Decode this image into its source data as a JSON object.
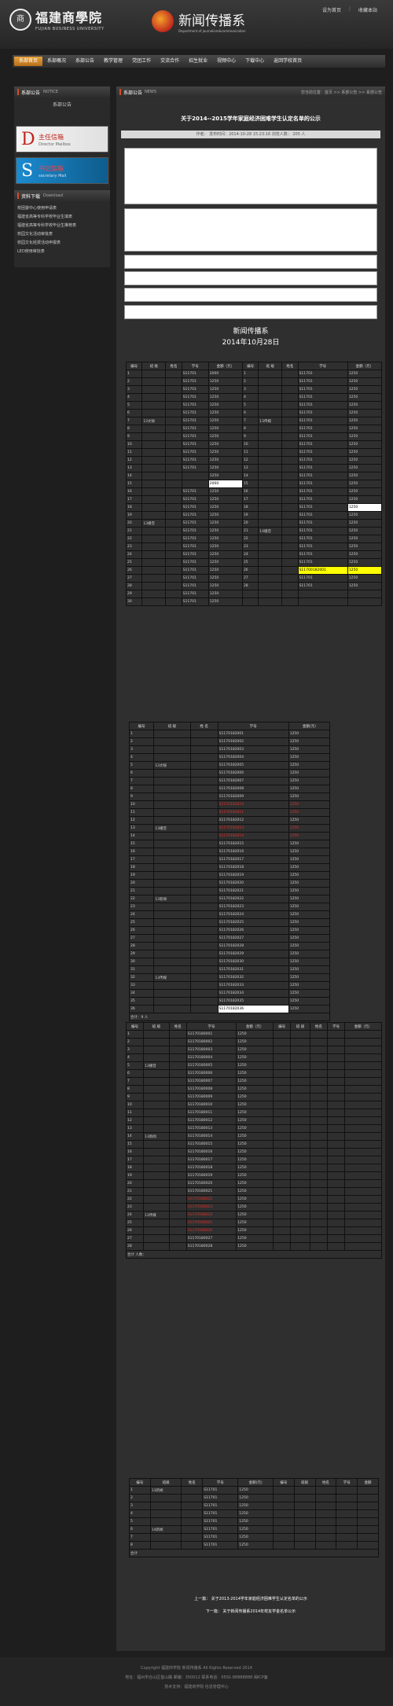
{
  "header": {
    "school_cn": "福建商學院",
    "school_en": "FUJIAN BUSINESS UNIVERSITY",
    "dept_cn": "新闻传播系",
    "dept_en": "Department of journalism&communication",
    "seal_char": "商",
    "top_links": [
      "设为首页",
      "收藏本站"
    ]
  },
  "nav": {
    "items": [
      "系部首页",
      "系部概况",
      "系部公告",
      "教学管理",
      "党团工作",
      "交流合作",
      "招生就业",
      "视频中心",
      "下载中心",
      "返回学校首页"
    ]
  },
  "sidebar": {
    "notice_title": "系部公告",
    "notice_en": "NOTICE",
    "notice_sub": "系部公告",
    "box1": {
      "letter": "D",
      "cn": "主任信箱",
      "en": "Director Mailbox"
    },
    "box2": {
      "letter": "S",
      "cn": "书记信箱",
      "en": "secretary Mail"
    },
    "download_title": "资料下载",
    "download_en": "Download",
    "downloads": [
      "校团委中心使用申请表",
      "福建省高等专科学校毕业生填表",
      "福建省高等专科学校毕业生推荐表",
      "校园文化活动审批表",
      "校园文化经费活动申报表",
      "LED使用审批表"
    ]
  },
  "main": {
    "title": "系部公告",
    "title_en": "NEWS",
    "breadcrumb": "您当前位置：首页 >> 系部公告 >> 系部公告",
    "article_title": "关于2014--2015学年家庭经济困难学生认定名单的公示",
    "article_meta": "作者： 发布时间：2014-10-28 15:23:16 浏览人数： 205 人",
    "dept_name": "新闻传播系",
    "date": "2014年10月28日",
    "prev_link": "上一篇： 关于2013-2014学年家庭经济困难学生认定名单的公示",
    "next_link": "下一篇： 关于新闻传播系2014年校友学金名单公示"
  },
  "table1": {
    "headers": [
      "编号",
      "班 级",
      "姓名",
      "学号",
      "金额（元）",
      "编号",
      "班 级",
      "姓名",
      "学号",
      "金额（元）"
    ],
    "left_rows": [
      [
        "1",
        "",
        "",
        "S11701",
        "2000"
      ],
      [
        "2",
        "",
        "",
        "S11701",
        "1250"
      ],
      [
        "3",
        "",
        "",
        "S11701",
        "1250"
      ],
      [
        "4",
        "",
        "",
        "S11701",
        "1250"
      ],
      [
        "5",
        "",
        "",
        "S11701",
        "1250"
      ],
      [
        "6",
        "",
        "",
        "S11701",
        "1250"
      ],
      [
        "7",
        "13文秘",
        "",
        "S11701",
        "1250"
      ],
      [
        "8",
        "",
        "",
        "S11701",
        "1250"
      ],
      [
        "9",
        "",
        "",
        "S11701",
        "1250"
      ],
      [
        "10",
        "",
        "",
        "S11701",
        "1250"
      ],
      [
        "11",
        "",
        "",
        "S11701",
        "1250"
      ],
      [
        "12",
        "",
        "",
        "S11701",
        "1250"
      ],
      [
        "13",
        "",
        "",
        "S11701",
        "1250"
      ],
      [
        "14",
        "",
        "",
        "",
        "1250"
      ],
      [
        "15",
        "",
        "",
        "",
        "2000"
      ],
      [
        "16",
        "",
        "",
        "S11701",
        "1250"
      ],
      [
        "17",
        "",
        "",
        "S11701",
        "1250"
      ],
      [
        "18",
        "",
        "",
        "S11701",
        "1250"
      ],
      [
        "19",
        "",
        "",
        "S11701",
        "1250"
      ],
      [
        "20",
        "13播音",
        "",
        "S11701",
        "1250"
      ],
      [
        "21",
        "",
        "",
        "S11701",
        "1250"
      ],
      [
        "22",
        "",
        "",
        "S11701",
        "1250"
      ],
      [
        "23",
        "",
        "",
        "S11701",
        "1250"
      ],
      [
        "24",
        "",
        "",
        "S11701",
        "1250"
      ],
      [
        "25",
        "",
        "",
        "S11701",
        "1250"
      ],
      [
        "26",
        "",
        "",
        "S11701",
        "1250"
      ],
      [
        "27",
        "",
        "",
        "S11701",
        "1250"
      ],
      [
        "28",
        "",
        "",
        "S11701",
        "1250"
      ],
      [
        "29",
        "",
        "",
        "S11701",
        "1250"
      ],
      [
        "30",
        "",
        "",
        "S11701",
        "1250"
      ]
    ],
    "right_class_a": "13传媒",
    "right_class_b": "14播音",
    "highlight_id": "S11700182001",
    "highlight_amount": "1250",
    "white_amount": "1250",
    "white_left": "2000"
  },
  "table2": {
    "headers": [
      "编号",
      "班 级",
      "姓 名",
      "学号",
      "金额(元)"
    ],
    "groups": [
      {
        "label": "13文秘",
        "start": 1,
        "end": 9
      },
      {
        "label": "13播音",
        "start": 10,
        "end": 16
      },
      {
        "label": "13新闻",
        "start": 17,
        "end": 27
      },
      {
        "label": "13传媒",
        "start": 28,
        "end": 36
      }
    ],
    "id_prefix": "S117",
    "amount": "1250",
    "red_rows": [
      10,
      11,
      13,
      14
    ],
    "highlight_row": 36,
    "summary": "合计：9 人"
  },
  "table3": {
    "headers": [
      "编号",
      "班 级",
      "姓名",
      "学号",
      "金额（元）",
      "编号",
      "班 级",
      "姓名",
      "学号",
      "金额（元）"
    ],
    "groups": [
      {
        "label": "13播音",
        "start": 1,
        "end": 9
      },
      {
        "label": "13新闻",
        "start": 10,
        "end": 19
      },
      {
        "label": "13传媒",
        "start": 20,
        "end": 28
      }
    ],
    "summary": "合计 人数："
  },
  "table4": {
    "headers": [
      "编号",
      "班级",
      "姓名",
      "学号",
      "金额(元)",
      "编号",
      "班级",
      "姓名",
      "学号",
      "金额"
    ],
    "rows": [
      [
        "1",
        "13新闻",
        "",
        "S11701",
        "1250"
      ],
      [
        "2",
        "",
        "",
        "S11701",
        "1250"
      ],
      [
        "3",
        "",
        "",
        "S11701",
        "1250"
      ],
      [
        "4",
        "",
        "",
        "S11701",
        "1250"
      ],
      [
        "5",
        "",
        "",
        "S11701",
        "1250"
      ],
      [
        "6",
        "14新闻",
        "",
        "S11701",
        "1250"
      ],
      [
        "7",
        "",
        "",
        "S11701",
        "1250"
      ],
      [
        "8",
        "",
        "",
        "S11701",
        "1250"
      ]
    ],
    "summary": "合计"
  },
  "footer": {
    "lines": [
      "Copyright 福建商学院 新闻传播系 All Rights Reserved 2014",
      "地址：福州市仓山区首山路 邮编：350012 联系电话：0591-88888888 闽ICP备",
      "技术支持：福建商学院 信息管理中心"
    ]
  }
}
